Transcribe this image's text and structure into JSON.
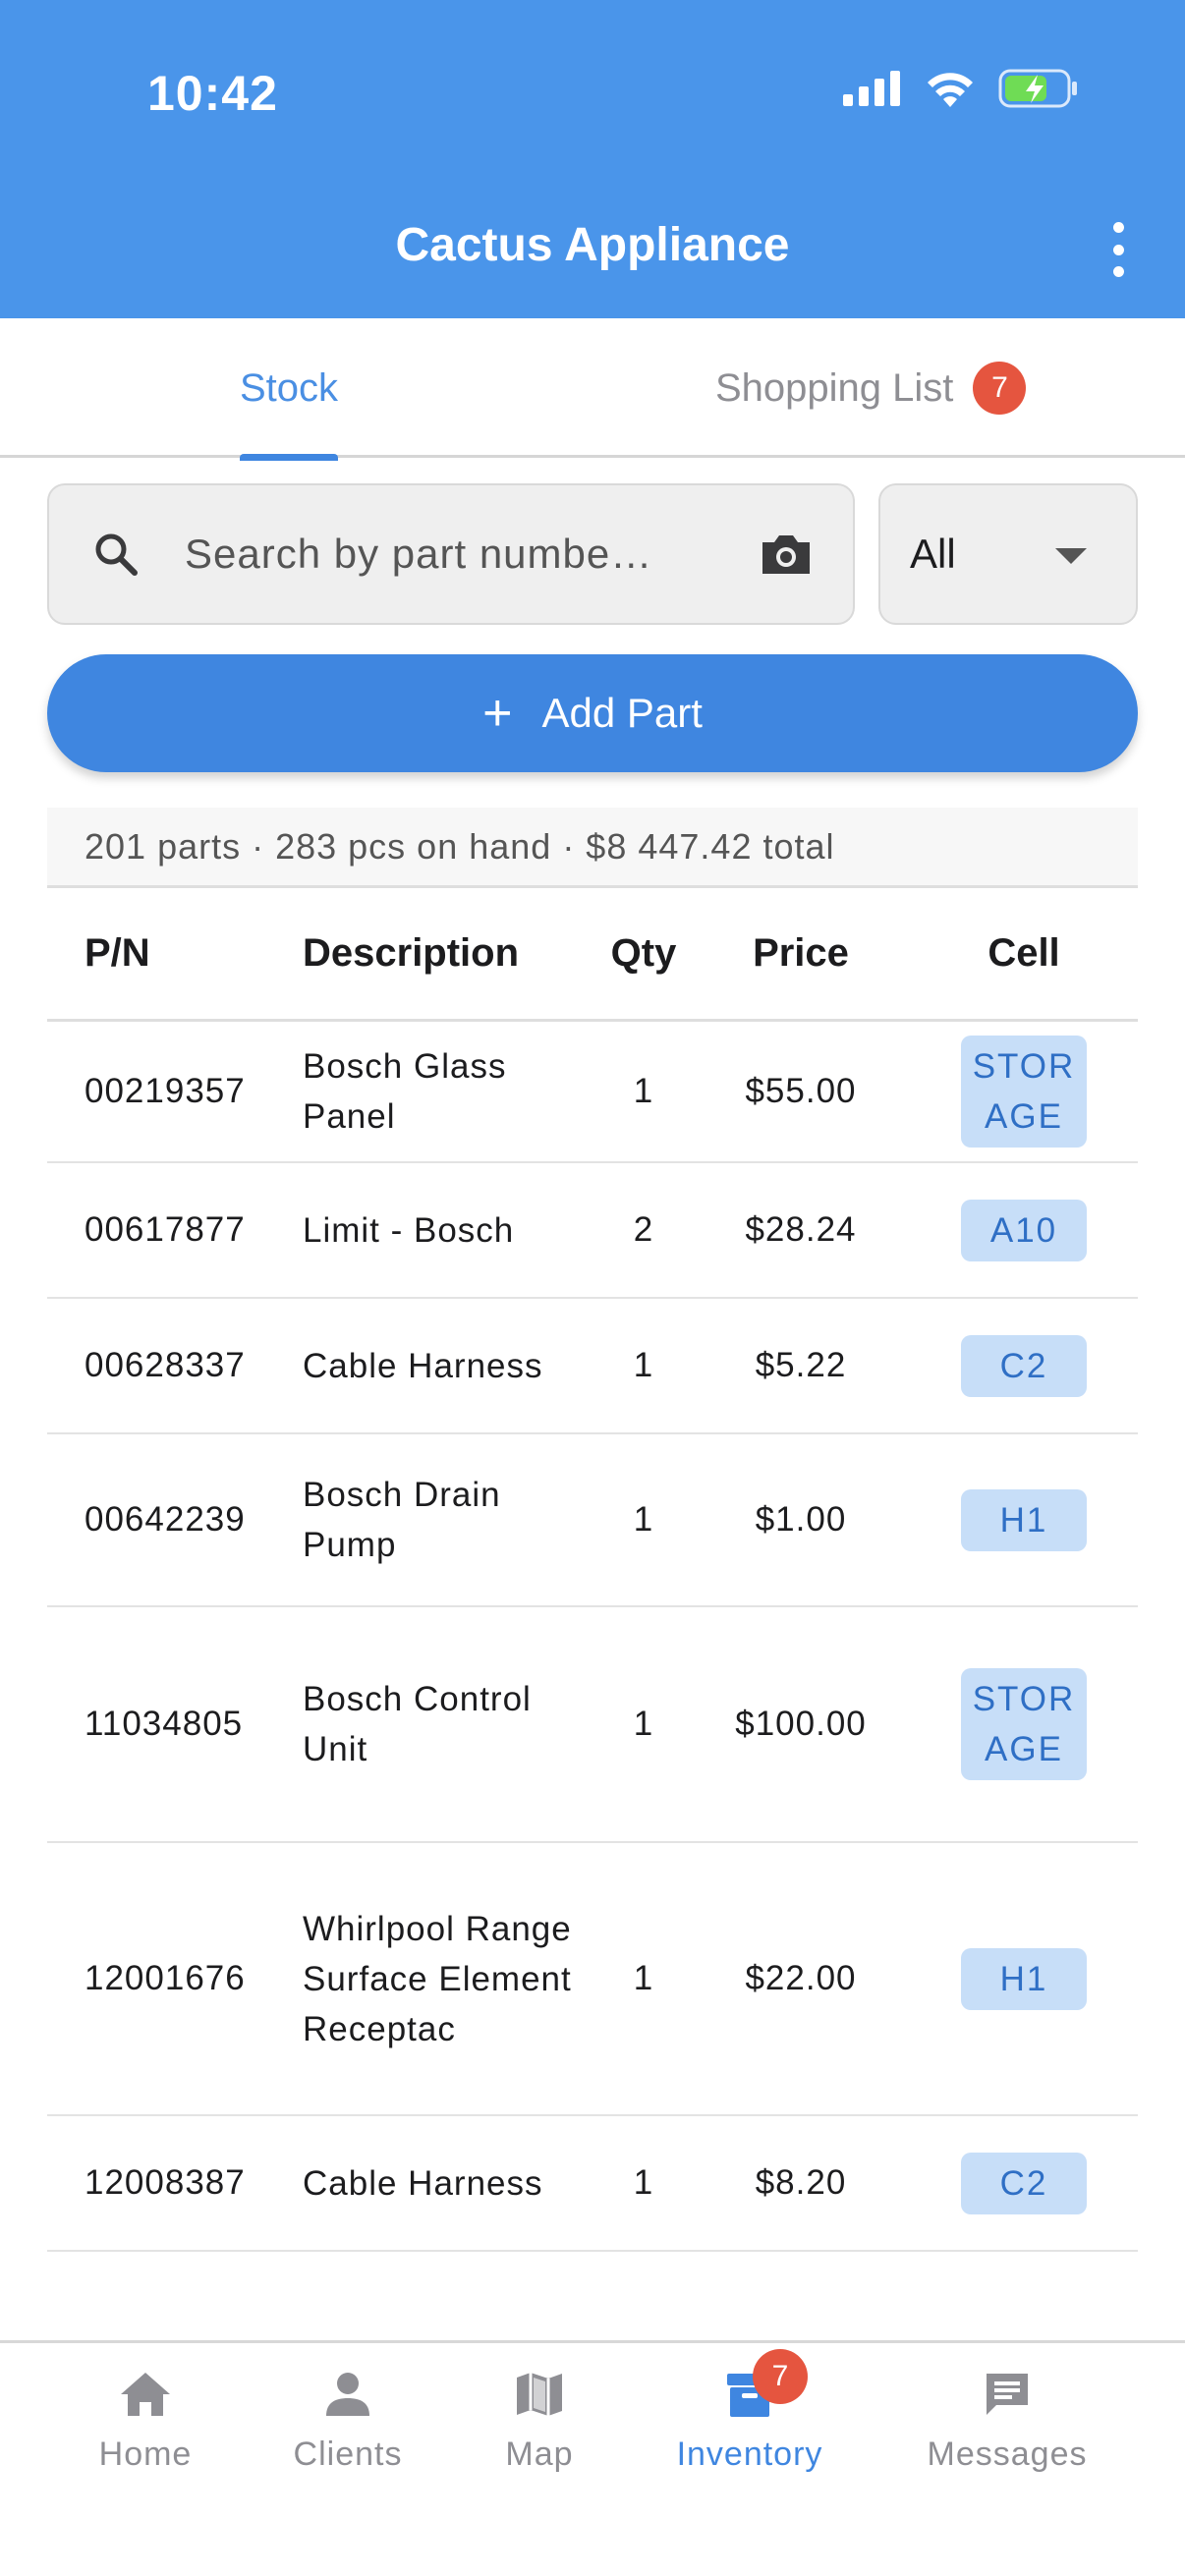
{
  "status_bar": {
    "time": "10:42"
  },
  "header": {
    "title": "Cactus Appliance"
  },
  "tabs": [
    {
      "label": "Stock",
      "active": true
    },
    {
      "label": "Shopping List",
      "badge": "7"
    }
  ],
  "search": {
    "placeholder": "Search by part numbe…"
  },
  "filter": {
    "selected": "All"
  },
  "add_button": {
    "label": "Add Part"
  },
  "summary": "201 parts · 283 pcs on hand · $8 447.42 total",
  "table": {
    "headers": {
      "pn": "P/N",
      "desc": "Description",
      "qty": "Qty",
      "price": "Price",
      "cell": "Cell"
    },
    "rows": [
      {
        "pn": "00219357",
        "desc": "Bosch Glass Panel",
        "qty": "1",
        "price": "$55.00",
        "cell": "STORAGE"
      },
      {
        "pn": "00617877",
        "desc": "Limit - Bosch",
        "qty": "2",
        "price": "$28.24",
        "cell": "A10"
      },
      {
        "pn": "00628337",
        "desc": "Cable Harness",
        "qty": "1",
        "price": "$5.22",
        "cell": "C2"
      },
      {
        "pn": "00642239",
        "desc": "Bosch Drain Pump",
        "qty": "1",
        "price": "$1.00",
        "cell": "H1"
      },
      {
        "pn": "11034805",
        "desc": "Bosch Control Unit",
        "qty": "1",
        "price": "$100.00",
        "cell": "STORAGE"
      },
      {
        "pn": "12001676",
        "desc": "Whirlpool Range Surface Element Receptac",
        "qty": "1",
        "price": "$22.00",
        "cell": "H1"
      },
      {
        "pn": "12008387",
        "desc": "Cable Harness",
        "qty": "1",
        "price": "$8.20",
        "cell": "C2"
      }
    ]
  },
  "bottom_nav": [
    {
      "label": "Home",
      "icon": "home-icon"
    },
    {
      "label": "Clients",
      "icon": "person-icon"
    },
    {
      "label": "Map",
      "icon": "map-icon"
    },
    {
      "label": "Inventory",
      "icon": "inventory-icon",
      "badge": "7",
      "active": true
    },
    {
      "label": "Messages",
      "icon": "message-icon"
    }
  ],
  "colors": {
    "header": "#4a95ea",
    "accent": "#3f86e0",
    "badge": "#e5553f",
    "chip_bg": "#c7def8",
    "chip_text": "#2f6fc5"
  }
}
